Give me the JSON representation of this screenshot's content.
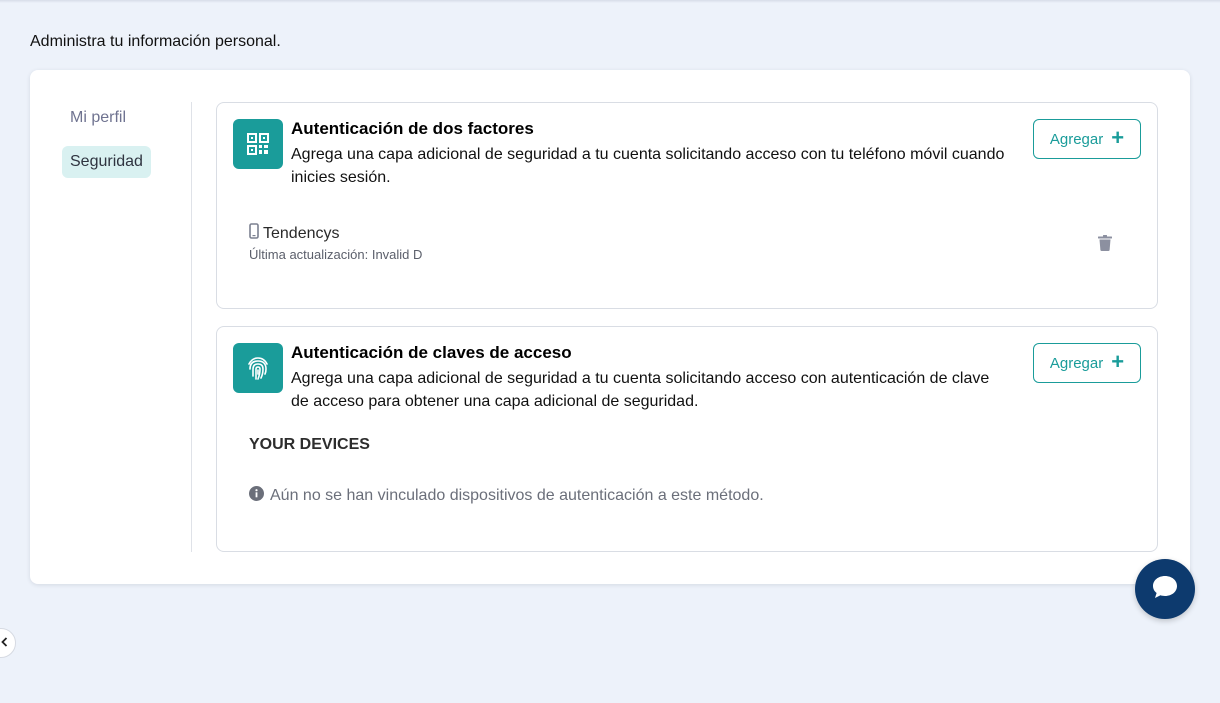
{
  "header": {
    "subtitle": "Administra tu información personal."
  },
  "sidebar": {
    "items": [
      {
        "label": "Mi perfil",
        "active": false
      },
      {
        "label": "Seguridad",
        "active": true
      }
    ]
  },
  "two_factor": {
    "icon": "qr-code-icon",
    "title": "Autenticación de dos factores",
    "description": "Agrega una capa adicional de seguridad a tu cuenta solicitando acceso con tu teléfono móvil cuando inicies sesión.",
    "add_label": "Agregar",
    "devices": [
      {
        "icon": "mobile-phone-icon",
        "name": "Tendencys",
        "updated": "Última actualización: Invalid D"
      }
    ]
  },
  "passkeys": {
    "icon": "fingerprint-icon",
    "title": "Autenticación de claves de acceso",
    "description": "Agrega una capa adicional de seguridad a tu cuenta solicitando acceso con autenticación de clave de acceso para obtener una capa adicional de seguridad.",
    "add_label": "Agregar",
    "devices_heading": "YOUR DEVICES",
    "empty_message": "Aún no se han vinculado dispositivos de autenticación a este método."
  },
  "colors": {
    "accent": "#1a9c9a",
    "active_nav_bg": "#d9f1f1",
    "chat_button": "#0d3a6e",
    "page_bg": "#edf2fa"
  }
}
